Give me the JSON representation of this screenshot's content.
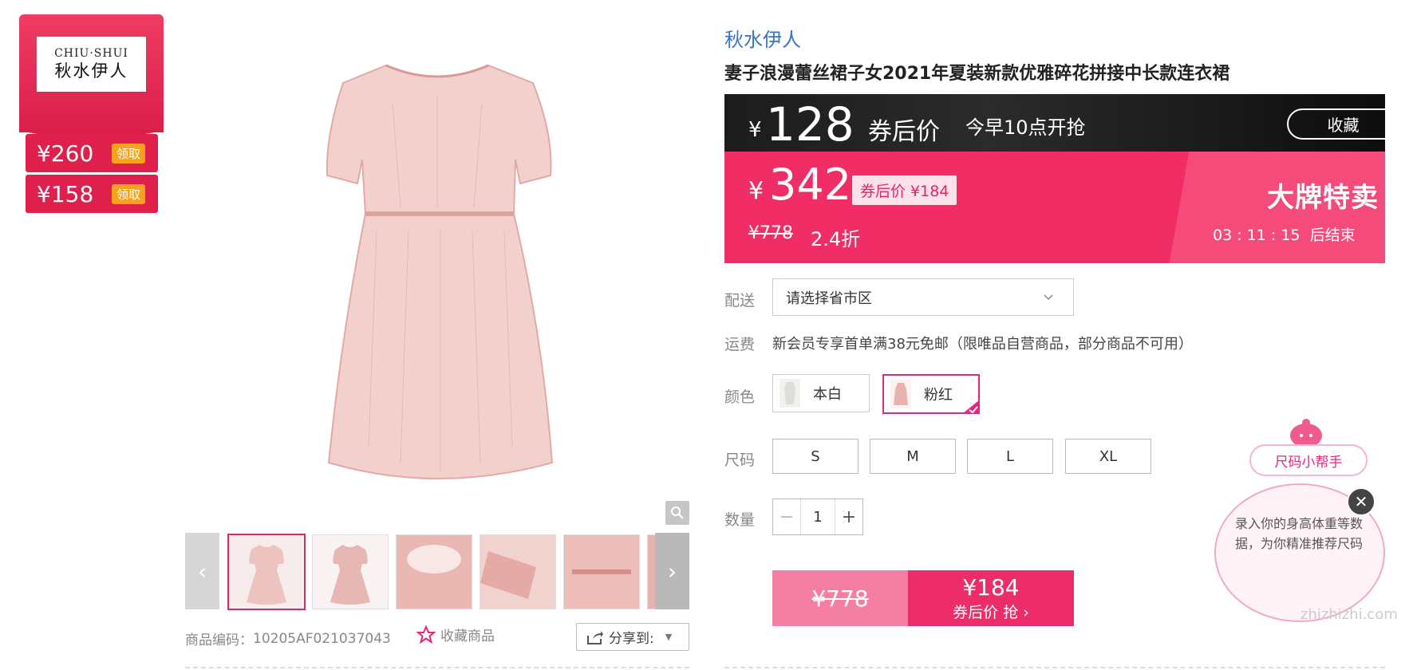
{
  "brand_badge": {
    "logo_en": "CHIU·SHUI",
    "logo_cn": "秋水伊人"
  },
  "coupons": [
    {
      "amount": "¥260",
      "action": "领取"
    },
    {
      "amount": "¥158",
      "action": "领取"
    }
  ],
  "gallery": {
    "zoom_icon": "magnifier-icon",
    "prev_arrow": "‹",
    "next_arrow": "›",
    "thumbnail_count": 6,
    "selected_thumbnail": 1
  },
  "product_meta": {
    "sku_label": "商品编码：",
    "sku_value": "10205AF021037043",
    "favorite_link": "收藏商品",
    "share_label": "分享到:"
  },
  "product": {
    "brand": "秋水伊人",
    "title": "妻子浪漫蕾丝裙子女2021年夏装新款优雅碎花拼接中长款连衣裙"
  },
  "promo_bar": {
    "currency": "¥",
    "price": "128",
    "after_label": "券后价",
    "start_text": "今早10点开抢",
    "favorite_button": "收藏"
  },
  "sale": {
    "currency": "¥",
    "price": "342",
    "after_coupon_tag": "券后价 ¥184",
    "original_price": "¥778",
    "discount": "2.4折",
    "banner": "大牌特卖",
    "countdown": "03 : 11 : 15",
    "countdown_suffix": "后结束"
  },
  "delivery": {
    "label": "配送",
    "placeholder": "请选择省市区"
  },
  "shipping": {
    "label": "运费",
    "text": "新会员专享首单满38元免邮（限唯品自营商品，部分商品不可用）"
  },
  "colors": {
    "label": "颜色",
    "options": [
      {
        "name": "本白",
        "swatch": "#e6e6e2",
        "selected": false
      },
      {
        "name": "粉红",
        "swatch": "#e8b3ad",
        "selected": true
      }
    ]
  },
  "sizes": {
    "label": "尺码",
    "options": [
      "S",
      "M",
      "L",
      "XL"
    ]
  },
  "quantity": {
    "label": "数量",
    "value": "1",
    "minus": "−",
    "plus": "+"
  },
  "buy": {
    "original_price": "¥778",
    "price": "¥184",
    "action": "券后价 抢 ›"
  },
  "size_helper": {
    "tag": "尺码小帮手",
    "text": "录入你的身高体重等数据，为你精准推荐尺码",
    "close": "✕"
  },
  "watermark": {
    "text": "zhizhizhi.com"
  },
  "colors_theme": {
    "accent": "#f12d65",
    "link": "#3774c6",
    "dark": "#1c1c1c"
  }
}
